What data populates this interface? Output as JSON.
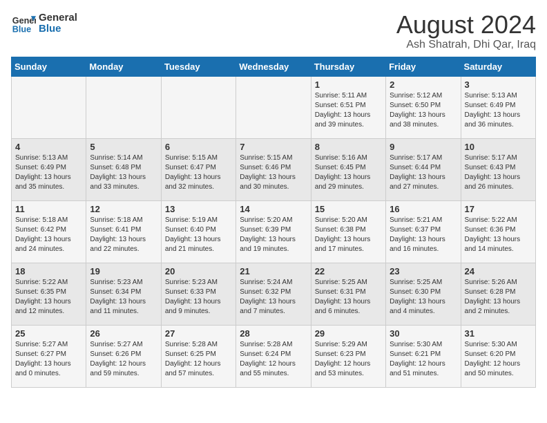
{
  "logo": {
    "line1": "General",
    "line2": "Blue"
  },
  "title": "August 2024",
  "location": "Ash Shatrah, Dhi Qar, Iraq",
  "days_of_week": [
    "Sunday",
    "Monday",
    "Tuesday",
    "Wednesday",
    "Thursday",
    "Friday",
    "Saturday"
  ],
  "weeks": [
    [
      {
        "day": "",
        "info": ""
      },
      {
        "day": "",
        "info": ""
      },
      {
        "day": "",
        "info": ""
      },
      {
        "day": "",
        "info": ""
      },
      {
        "day": "1",
        "info": "Sunrise: 5:11 AM\nSunset: 6:51 PM\nDaylight: 13 hours\nand 39 minutes."
      },
      {
        "day": "2",
        "info": "Sunrise: 5:12 AM\nSunset: 6:50 PM\nDaylight: 13 hours\nand 38 minutes."
      },
      {
        "day": "3",
        "info": "Sunrise: 5:13 AM\nSunset: 6:49 PM\nDaylight: 13 hours\nand 36 minutes."
      }
    ],
    [
      {
        "day": "4",
        "info": "Sunrise: 5:13 AM\nSunset: 6:49 PM\nDaylight: 13 hours\nand 35 minutes."
      },
      {
        "day": "5",
        "info": "Sunrise: 5:14 AM\nSunset: 6:48 PM\nDaylight: 13 hours\nand 33 minutes."
      },
      {
        "day": "6",
        "info": "Sunrise: 5:15 AM\nSunset: 6:47 PM\nDaylight: 13 hours\nand 32 minutes."
      },
      {
        "day": "7",
        "info": "Sunrise: 5:15 AM\nSunset: 6:46 PM\nDaylight: 13 hours\nand 30 minutes."
      },
      {
        "day": "8",
        "info": "Sunrise: 5:16 AM\nSunset: 6:45 PM\nDaylight: 13 hours\nand 29 minutes."
      },
      {
        "day": "9",
        "info": "Sunrise: 5:17 AM\nSunset: 6:44 PM\nDaylight: 13 hours\nand 27 minutes."
      },
      {
        "day": "10",
        "info": "Sunrise: 5:17 AM\nSunset: 6:43 PM\nDaylight: 13 hours\nand 26 minutes."
      }
    ],
    [
      {
        "day": "11",
        "info": "Sunrise: 5:18 AM\nSunset: 6:42 PM\nDaylight: 13 hours\nand 24 minutes."
      },
      {
        "day": "12",
        "info": "Sunrise: 5:18 AM\nSunset: 6:41 PM\nDaylight: 13 hours\nand 22 minutes."
      },
      {
        "day": "13",
        "info": "Sunrise: 5:19 AM\nSunset: 6:40 PM\nDaylight: 13 hours\nand 21 minutes."
      },
      {
        "day": "14",
        "info": "Sunrise: 5:20 AM\nSunset: 6:39 PM\nDaylight: 13 hours\nand 19 minutes."
      },
      {
        "day": "15",
        "info": "Sunrise: 5:20 AM\nSunset: 6:38 PM\nDaylight: 13 hours\nand 17 minutes."
      },
      {
        "day": "16",
        "info": "Sunrise: 5:21 AM\nSunset: 6:37 PM\nDaylight: 13 hours\nand 16 minutes."
      },
      {
        "day": "17",
        "info": "Sunrise: 5:22 AM\nSunset: 6:36 PM\nDaylight: 13 hours\nand 14 minutes."
      }
    ],
    [
      {
        "day": "18",
        "info": "Sunrise: 5:22 AM\nSunset: 6:35 PM\nDaylight: 13 hours\nand 12 minutes."
      },
      {
        "day": "19",
        "info": "Sunrise: 5:23 AM\nSunset: 6:34 PM\nDaylight: 13 hours\nand 11 minutes."
      },
      {
        "day": "20",
        "info": "Sunrise: 5:23 AM\nSunset: 6:33 PM\nDaylight: 13 hours\nand 9 minutes."
      },
      {
        "day": "21",
        "info": "Sunrise: 5:24 AM\nSunset: 6:32 PM\nDaylight: 13 hours\nand 7 minutes."
      },
      {
        "day": "22",
        "info": "Sunrise: 5:25 AM\nSunset: 6:31 PM\nDaylight: 13 hours\nand 6 minutes."
      },
      {
        "day": "23",
        "info": "Sunrise: 5:25 AM\nSunset: 6:30 PM\nDaylight: 13 hours\nand 4 minutes."
      },
      {
        "day": "24",
        "info": "Sunrise: 5:26 AM\nSunset: 6:28 PM\nDaylight: 13 hours\nand 2 minutes."
      }
    ],
    [
      {
        "day": "25",
        "info": "Sunrise: 5:27 AM\nSunset: 6:27 PM\nDaylight: 13 hours\nand 0 minutes."
      },
      {
        "day": "26",
        "info": "Sunrise: 5:27 AM\nSunset: 6:26 PM\nDaylight: 12 hours\nand 59 minutes."
      },
      {
        "day": "27",
        "info": "Sunrise: 5:28 AM\nSunset: 6:25 PM\nDaylight: 12 hours\nand 57 minutes."
      },
      {
        "day": "28",
        "info": "Sunrise: 5:28 AM\nSunset: 6:24 PM\nDaylight: 12 hours\nand 55 minutes."
      },
      {
        "day": "29",
        "info": "Sunrise: 5:29 AM\nSunset: 6:23 PM\nDaylight: 12 hours\nand 53 minutes."
      },
      {
        "day": "30",
        "info": "Sunrise: 5:30 AM\nSunset: 6:21 PM\nDaylight: 12 hours\nand 51 minutes."
      },
      {
        "day": "31",
        "info": "Sunrise: 5:30 AM\nSunset: 6:20 PM\nDaylight: 12 hours\nand 50 minutes."
      }
    ]
  ]
}
